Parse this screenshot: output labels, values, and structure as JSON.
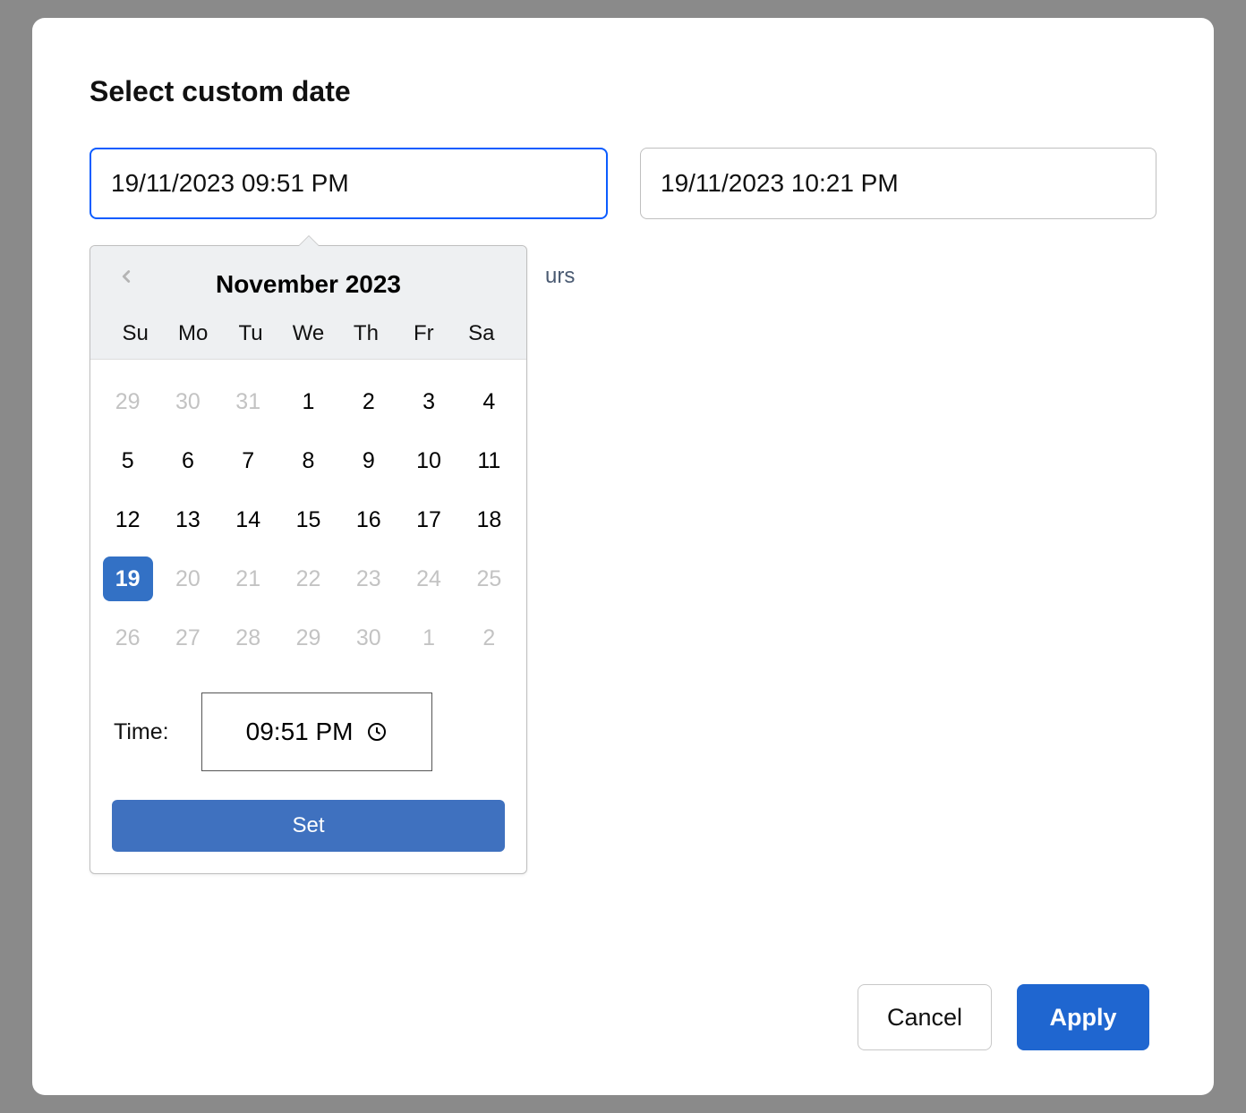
{
  "modal": {
    "title": "Select custom date",
    "bgText": "urs"
  },
  "inputs": {
    "start": "19/11/2023 09:51 PM",
    "end": "19/11/2023 10:21 PM"
  },
  "picker": {
    "monthLabel": "November 2023",
    "weekdays": [
      "Su",
      "Mo",
      "Tu",
      "We",
      "Th",
      "Fr",
      "Sa"
    ],
    "days": [
      {
        "n": "29",
        "muted": true,
        "selected": false
      },
      {
        "n": "30",
        "muted": true,
        "selected": false
      },
      {
        "n": "31",
        "muted": true,
        "selected": false
      },
      {
        "n": "1",
        "muted": false,
        "selected": false
      },
      {
        "n": "2",
        "muted": false,
        "selected": false
      },
      {
        "n": "3",
        "muted": false,
        "selected": false
      },
      {
        "n": "4",
        "muted": false,
        "selected": false
      },
      {
        "n": "5",
        "muted": false,
        "selected": false
      },
      {
        "n": "6",
        "muted": false,
        "selected": false
      },
      {
        "n": "7",
        "muted": false,
        "selected": false
      },
      {
        "n": "8",
        "muted": false,
        "selected": false
      },
      {
        "n": "9",
        "muted": false,
        "selected": false
      },
      {
        "n": "10",
        "muted": false,
        "selected": false
      },
      {
        "n": "11",
        "muted": false,
        "selected": false
      },
      {
        "n": "12",
        "muted": false,
        "selected": false
      },
      {
        "n": "13",
        "muted": false,
        "selected": false
      },
      {
        "n": "14",
        "muted": false,
        "selected": false
      },
      {
        "n": "15",
        "muted": false,
        "selected": false
      },
      {
        "n": "16",
        "muted": false,
        "selected": false
      },
      {
        "n": "17",
        "muted": false,
        "selected": false
      },
      {
        "n": "18",
        "muted": false,
        "selected": false
      },
      {
        "n": "19",
        "muted": false,
        "selected": true
      },
      {
        "n": "20",
        "muted": true,
        "selected": false
      },
      {
        "n": "21",
        "muted": true,
        "selected": false
      },
      {
        "n": "22",
        "muted": true,
        "selected": false
      },
      {
        "n": "23",
        "muted": true,
        "selected": false
      },
      {
        "n": "24",
        "muted": true,
        "selected": false
      },
      {
        "n": "25",
        "muted": true,
        "selected": false
      },
      {
        "n": "26",
        "muted": true,
        "selected": false
      },
      {
        "n": "27",
        "muted": true,
        "selected": false
      },
      {
        "n": "28",
        "muted": true,
        "selected": false
      },
      {
        "n": "29",
        "muted": true,
        "selected": false
      },
      {
        "n": "30",
        "muted": true,
        "selected": false
      },
      {
        "n": "1",
        "muted": true,
        "selected": false
      },
      {
        "n": "2",
        "muted": true,
        "selected": false
      }
    ],
    "timeLabel": "Time:",
    "timeValue": "09:51 PM",
    "setLabel": "Set"
  },
  "footer": {
    "cancel": "Cancel",
    "apply": "Apply"
  }
}
